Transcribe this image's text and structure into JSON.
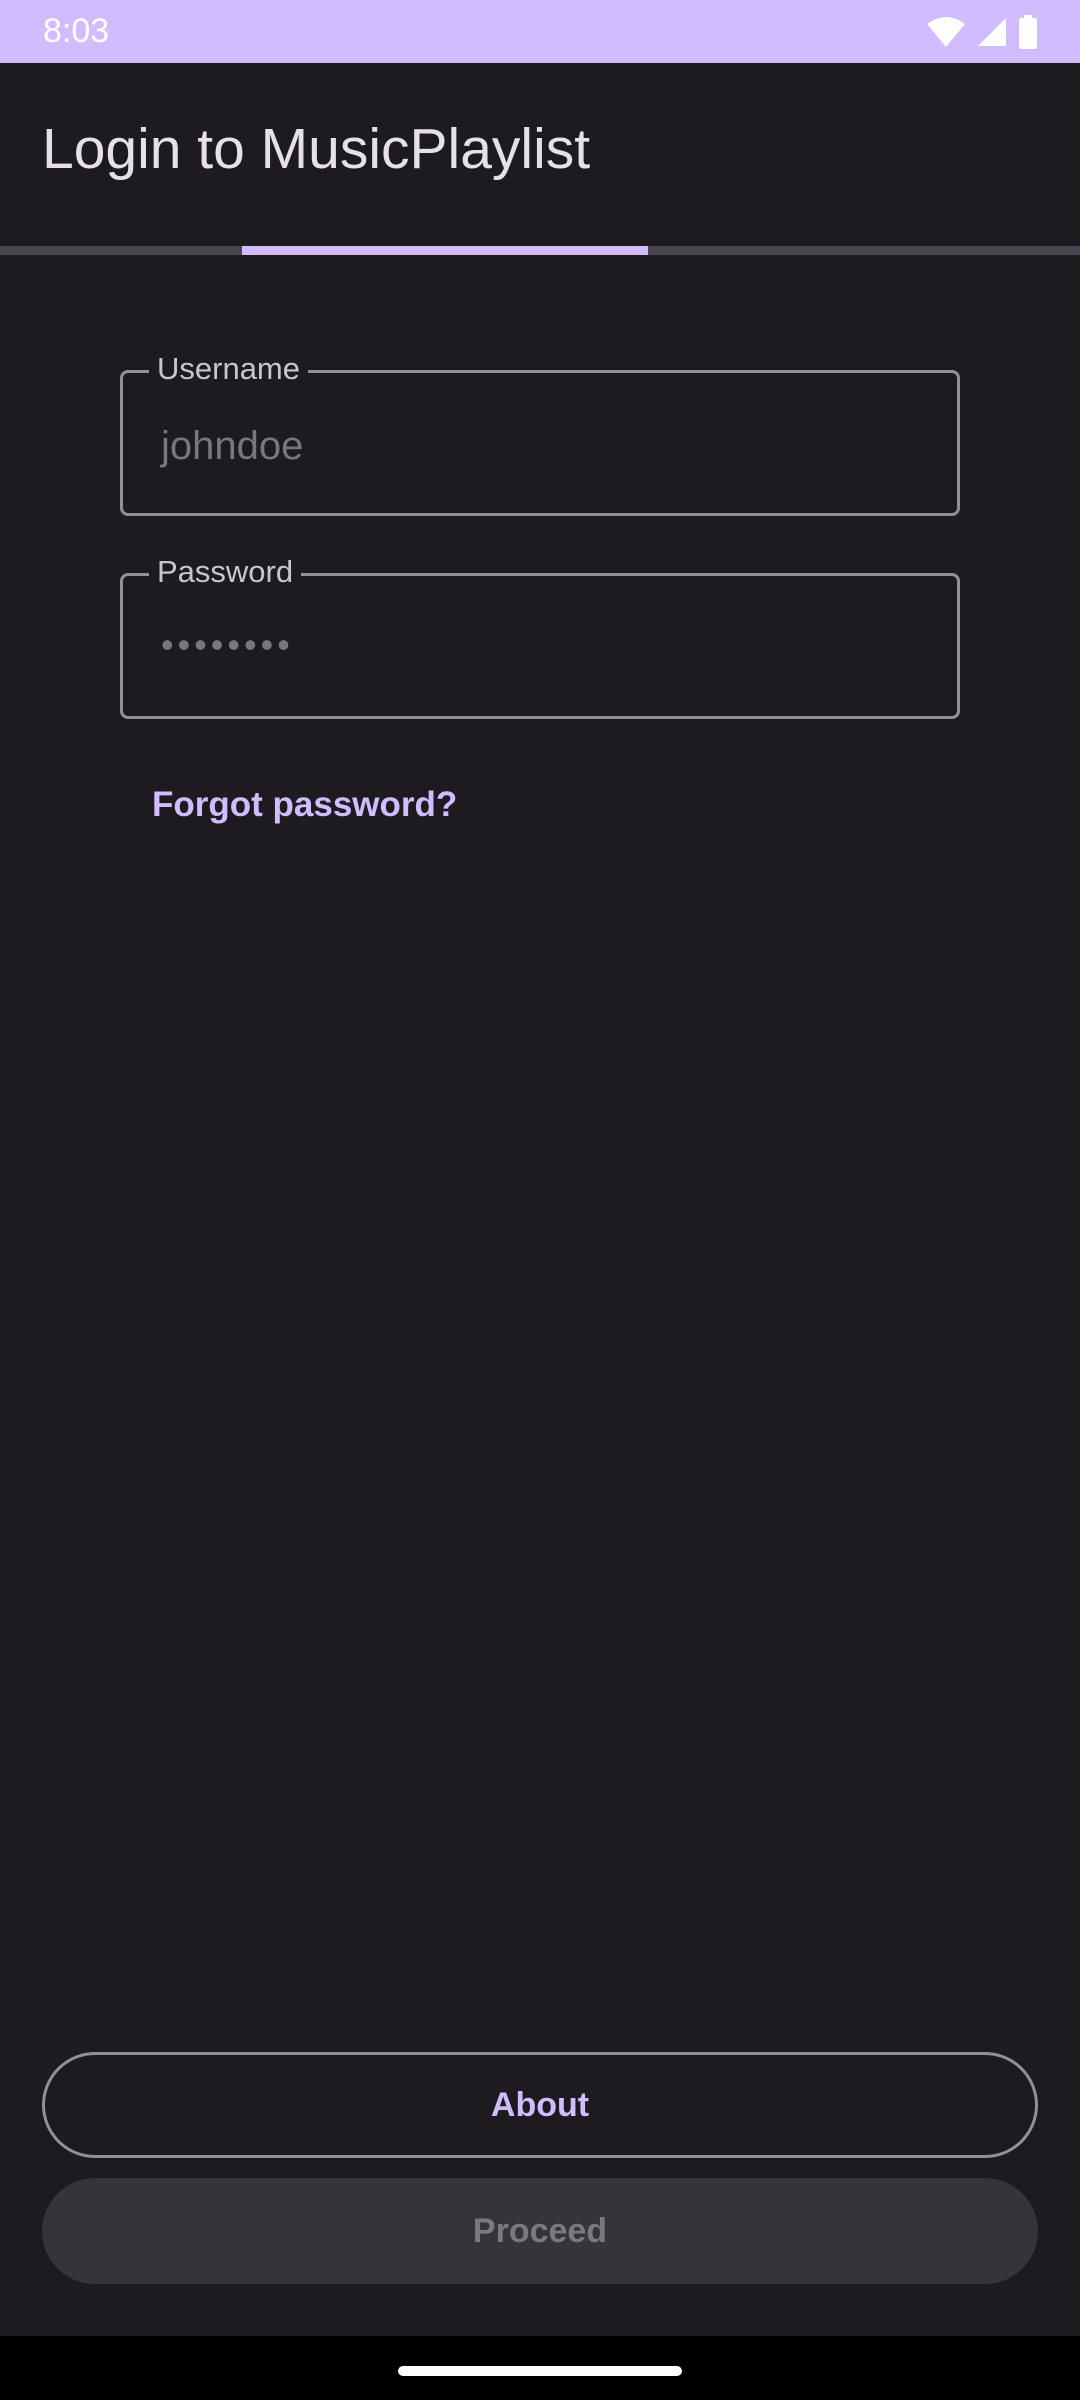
{
  "status_bar": {
    "time": "8:03",
    "icons": [
      "wifi-icon",
      "signal-icon",
      "battery-icon"
    ]
  },
  "app_bar": {
    "title": "Login to MusicPlaylist"
  },
  "progress": {
    "start_fraction": 0.224,
    "end_fraction": 0.6,
    "color": "#d0bcff"
  },
  "form": {
    "username": {
      "label": "Username",
      "placeholder": "johndoe"
    },
    "password": {
      "label": "Password",
      "value": "••••••••"
    },
    "forgot_password": "Forgot password?"
  },
  "actions": {
    "about": "About",
    "proceed": "Proceed"
  },
  "colors": {
    "accent": "#d0bcff",
    "background": "#1d1b20",
    "outline": "#938f99",
    "disabled_fill": "#36343b"
  }
}
